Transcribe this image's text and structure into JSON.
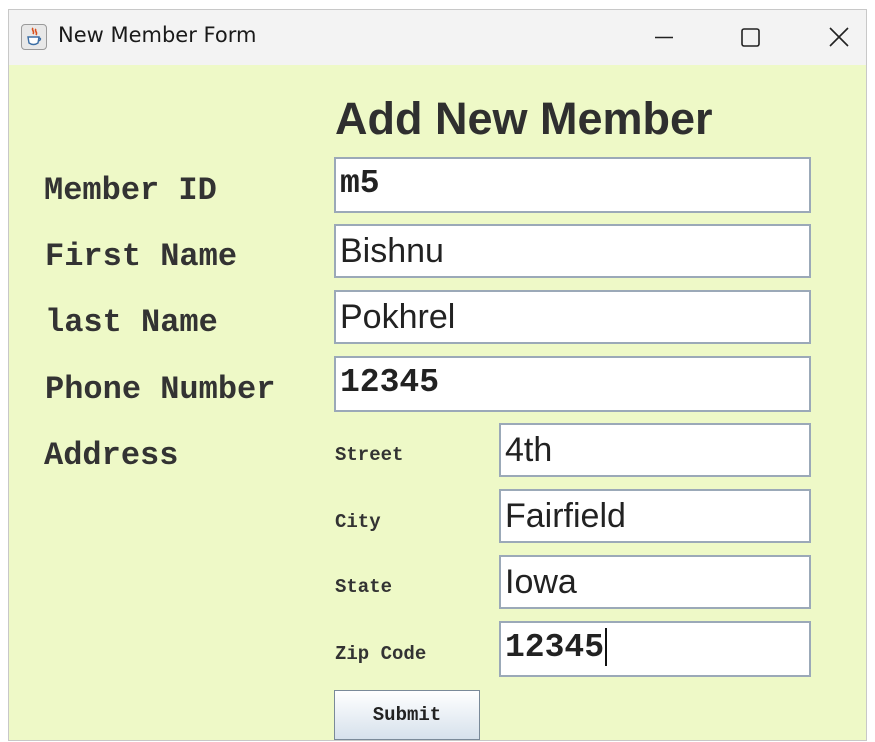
{
  "window": {
    "title": "New Member Form",
    "background_color": "#eef9c7",
    "app_icon": "java-cup-icon",
    "controls": [
      "minimize-icon",
      "maximize-icon",
      "close-icon"
    ]
  },
  "form": {
    "heading": "Add New Member",
    "fields": {
      "member_id": {
        "label": "Member ID",
        "value": "m5"
      },
      "first_name": {
        "label": "First Name",
        "value": "Bishnu"
      },
      "last_name": {
        "label": "last Name",
        "value": "Pokhrel"
      },
      "phone": {
        "label": "Phone Number",
        "value": "12345"
      }
    },
    "address": {
      "label": "Address",
      "street": {
        "label": "Street",
        "value": "4th"
      },
      "city": {
        "label": "City",
        "value": "Fairfield"
      },
      "state": {
        "label": "State",
        "value": "Iowa"
      },
      "zip": {
        "label": "Zip Code",
        "value": "12345"
      }
    },
    "submit_label": "Submit"
  }
}
